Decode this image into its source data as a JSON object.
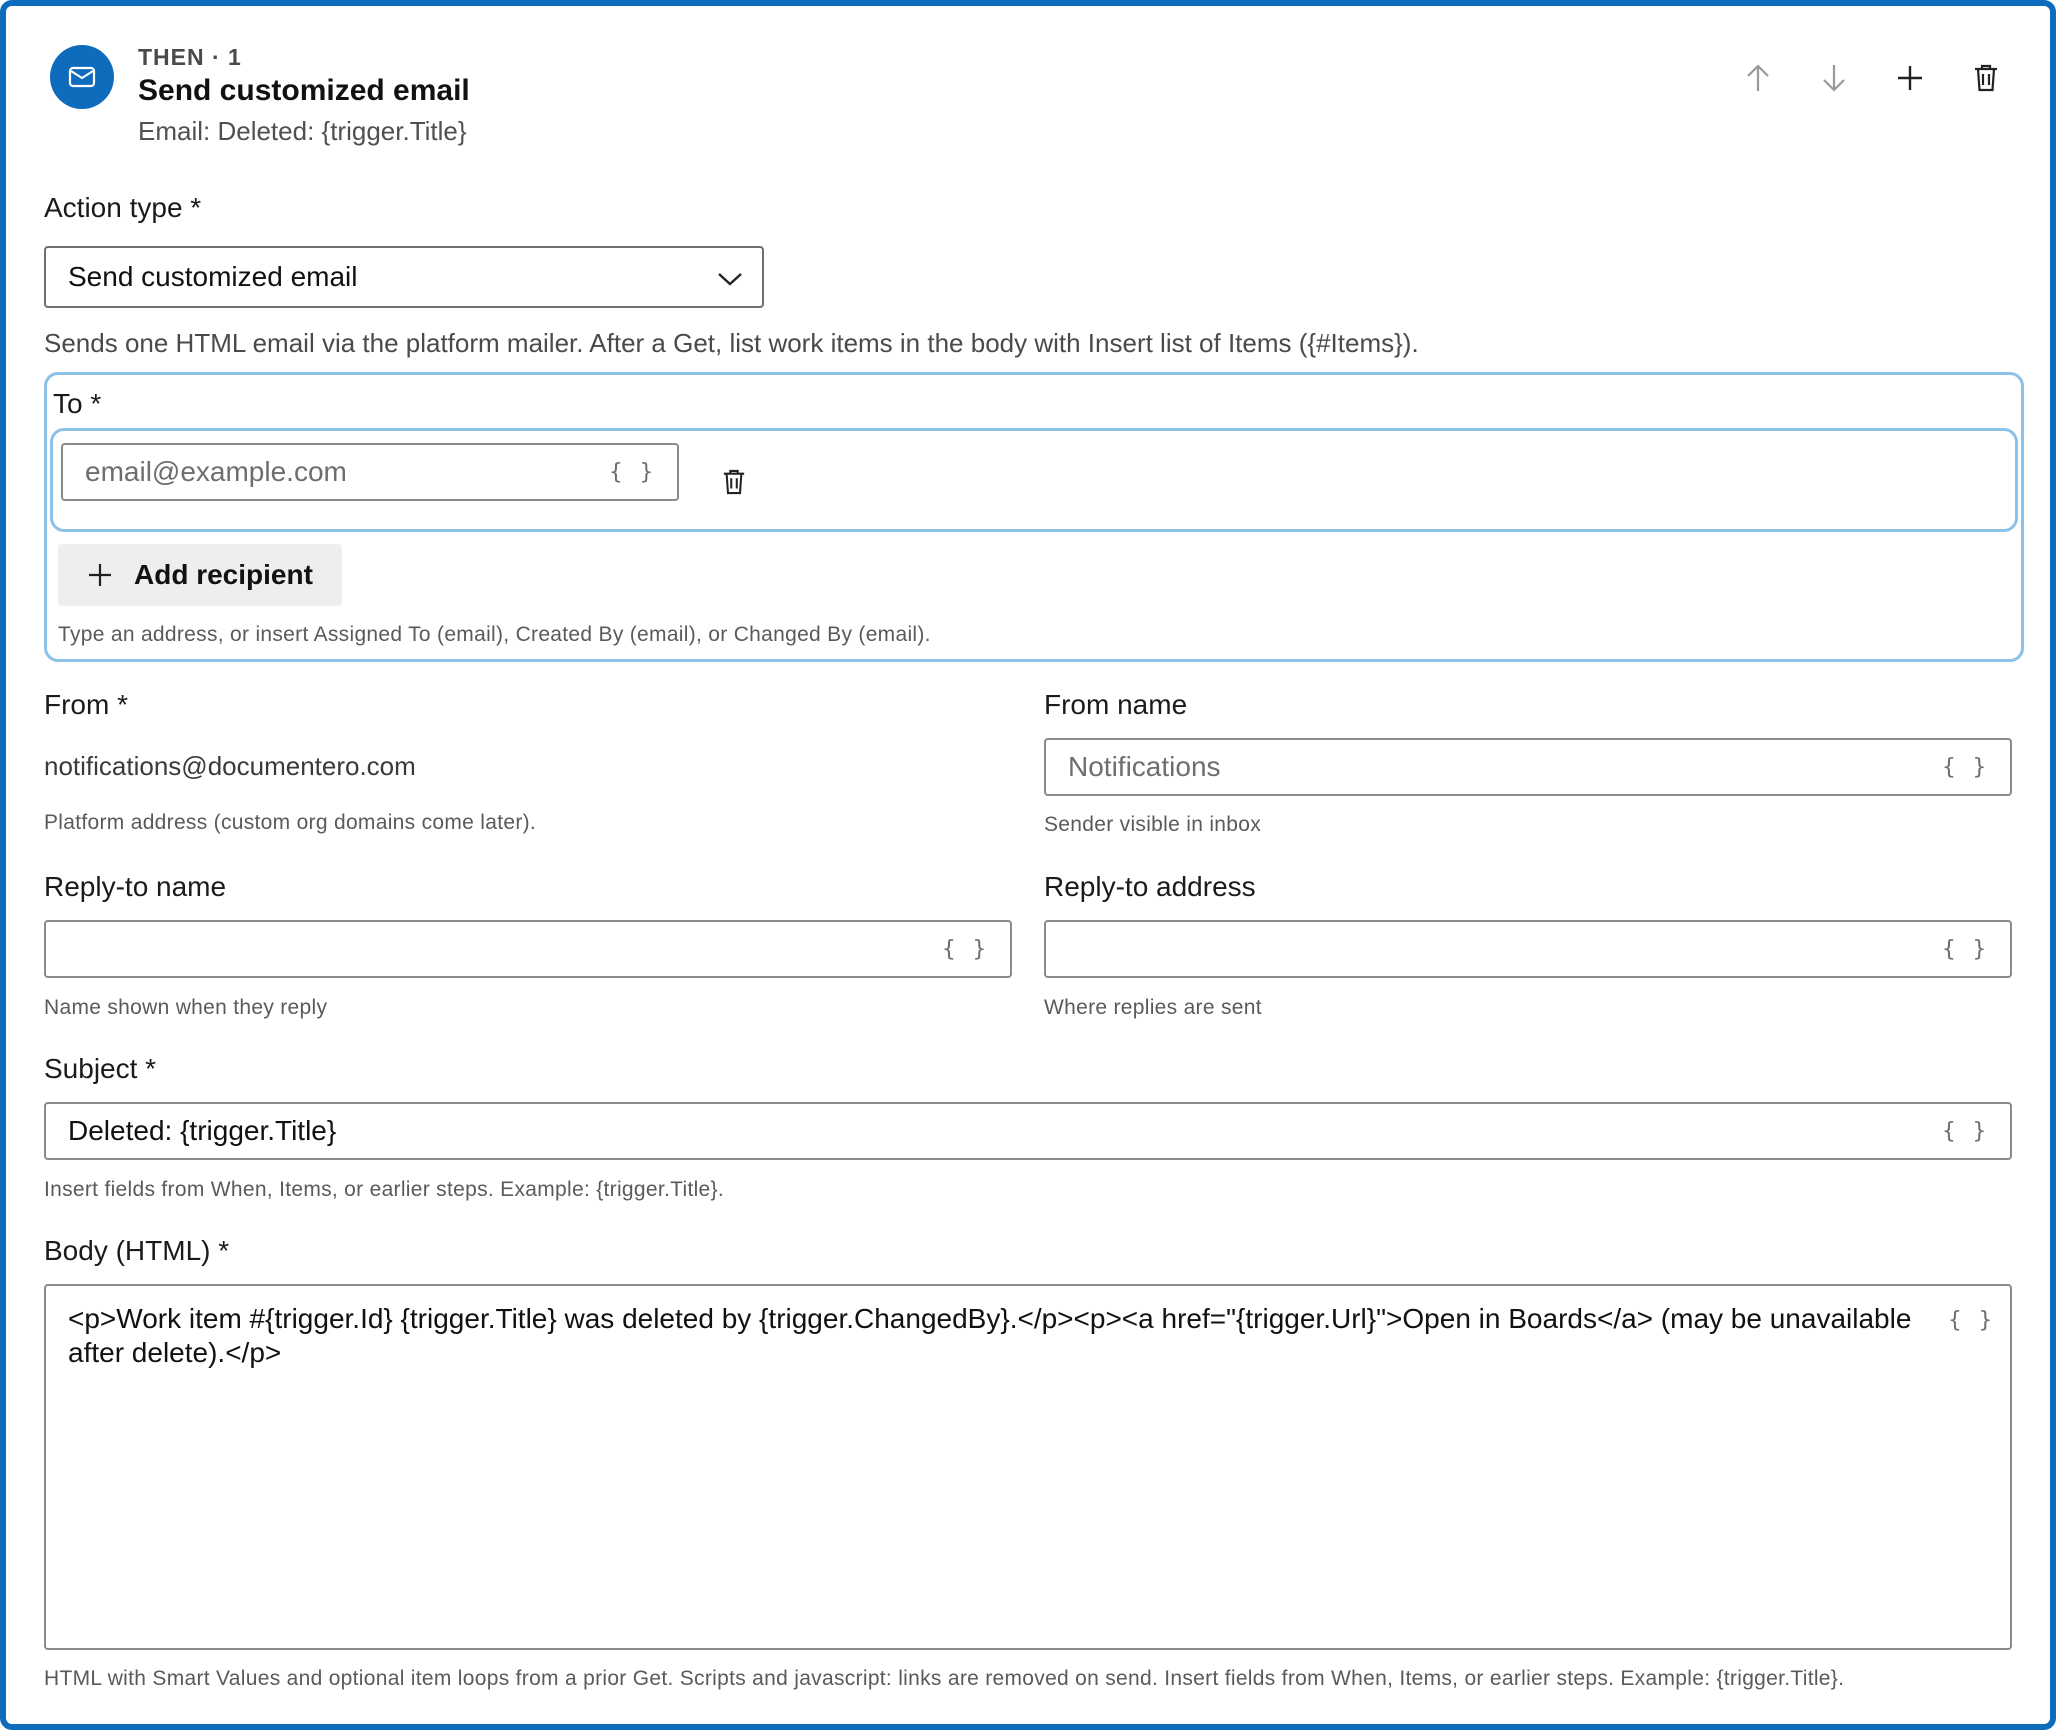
{
  "header": {
    "eyebrow": "THEN · 1",
    "title": "Send customized email",
    "subtitle": "Email: Deleted: {trigger.Title}",
    "icon": "mail-icon",
    "actions": [
      "arrow-up-icon",
      "arrow-down-icon",
      "plus-icon",
      "trash-icon"
    ]
  },
  "action_type": {
    "label": "Action type *",
    "value": "Send customized email",
    "description": "Sends one HTML email via the platform mailer. After a Get, list work items in the body with Insert list of Items ({#Items})."
  },
  "to": {
    "label": "To *",
    "placeholder": "email@example.com",
    "braces": "{ }",
    "add_label": "Add recipient",
    "help": "Type an address, or insert Assigned To (email), Created By (email), or Changed By (email)."
  },
  "from": {
    "label": "From *",
    "value": "notifications@documentero.com",
    "help": "Platform address (custom org domains come later)."
  },
  "from_name": {
    "label": "From name",
    "placeholder": "Notifications",
    "braces": "{ }",
    "help": "Sender visible in inbox"
  },
  "reply_to_name": {
    "label": "Reply-to name",
    "value": "",
    "braces": "{ }",
    "help": "Name shown when they reply"
  },
  "reply_to_address": {
    "label": "Reply-to address",
    "value": "",
    "braces": "{ }",
    "help": "Where replies are sent"
  },
  "subject": {
    "label": "Subject *",
    "value": "Deleted: {trigger.Title}",
    "braces": "{ }",
    "help": "Insert fields from When, Items, or earlier steps. Example: {trigger.Title}."
  },
  "body": {
    "label": "Body (HTML) *",
    "value": "<p>Work item #{trigger.Id} {trigger.Title} was deleted by {trigger.ChangedBy}.</p><p><a href=\"{trigger.Url}\">Open in Boards</a> (may be unavailable after delete).</p>",
    "braces": "{ }",
    "help": "HTML with Smart Values and optional item loops from a prior Get. Scripts and javascript: links are removed on send. Insert fields from When, Items, or earlier steps. Example: {trigger.Title}."
  },
  "colors": {
    "accent": "#0f6cbd",
    "focus_border": "#8cc1e8"
  }
}
